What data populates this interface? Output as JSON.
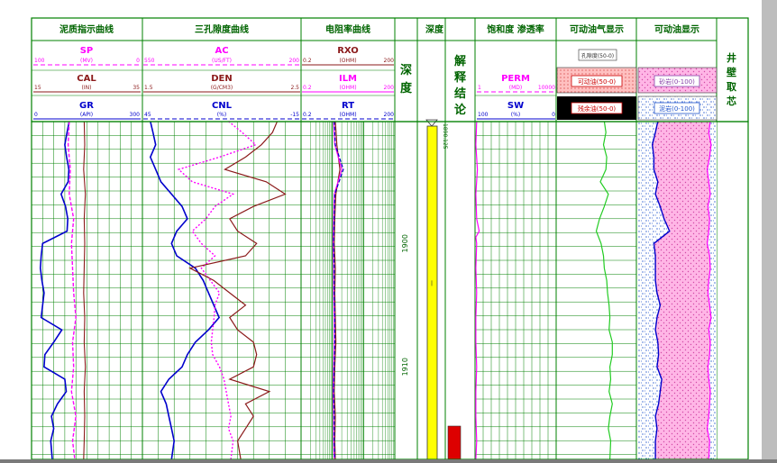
{
  "chart_data": {
    "type": "line",
    "title": "",
    "tracks": [
      {
        "id": "t1",
        "header": "泥质指示曲线",
        "curves": [
          {
            "name": "SP",
            "unit": "(MV)",
            "min": "100",
            "max": "0",
            "color": "#ff00ff"
          },
          {
            "name": "CAL",
            "unit": "(IN)",
            "min": "15",
            "max": "35",
            "color": "#8b1a1a"
          },
          {
            "name": "GR",
            "unit": "(API)",
            "min": "0",
            "max": "300",
            "color": "#0000ff"
          }
        ]
      },
      {
        "id": "t2",
        "header": "三孔隙度曲线",
        "curves": [
          {
            "name": "AC",
            "unit": "(US/FT)",
            "min": "550",
            "max": "200",
            "color": "#ff00ff"
          },
          {
            "name": "DEN",
            "unit": "(G/CM3)",
            "min": "1.5",
            "max": "2.5",
            "color": "#8b1a1a"
          },
          {
            "name": "CNL",
            "unit": "(%)",
            "min": "45",
            "max": "-15",
            "color": "#0000ff"
          }
        ]
      },
      {
        "id": "t3",
        "header": "电阻率曲线",
        "curves": [
          {
            "name": "RXO",
            "unit": "(OHM)",
            "min": "0.2",
            "max": "200",
            "color": "#8b1a1a"
          },
          {
            "name": "ILM",
            "unit": "(OHM)",
            "min": "0.2",
            "max": "200",
            "color": "#ff00ff"
          },
          {
            "name": "RT",
            "unit": "(OHM)",
            "min": "0.2",
            "max": "200",
            "color": "#0000ff"
          }
        ]
      },
      {
        "id": "t4",
        "header": "深度",
        "label": "深度"
      },
      {
        "id": "t5",
        "label": "解释结论"
      },
      {
        "id": "t6",
        "header": "饱和度 渗透率",
        "curves": [
          {
            "name": "PERM",
            "unit": "(MD)",
            "min": "1",
            "max": "10000",
            "color": "#ff00ff"
          },
          {
            "name": "SW",
            "unit": "(%)",
            "min": "100",
            "max": "0",
            "color": "#0000ff"
          }
        ]
      },
      {
        "id": "t7",
        "header": "可动油气显示",
        "legend": [
          "孔隙度(50-0)",
          "可动油(50-0)",
          "残余油(50-0)"
        ]
      },
      {
        "id": "t8",
        "header": "可动油显示",
        "legend": [
          "砂岩(0-100)",
          "泥岩(0-100)"
        ]
      },
      {
        "id": "t9",
        "label": "井壁取芯"
      }
    ],
    "depth_ticks": [
      {
        "depth": 1900,
        "label": "1900"
      },
      {
        "depth": 1910,
        "label": "1910"
      }
    ],
    "depth_top_label": "1890.125",
    "depth_range": [
      1890.125,
      1917.5
    ],
    "curves": {
      "GR": {
        "depth": [
          1890.1,
          1891,
          1892,
          1893,
          1894,
          1895,
          1896,
          1897,
          1898,
          1899,
          1900,
          1901,
          1902,
          1903,
          1904,
          1905,
          1906,
          1907,
          1908,
          1909,
          1910,
          1911,
          1912,
          1913,
          1914,
          1915,
          1916,
          1917.5
        ],
        "value": [
          102,
          96,
          90,
          95,
          101,
          99,
          80,
          92,
          98,
          96,
          30,
          26,
          24,
          28,
          34,
          30,
          26,
          82,
          60,
          36,
          34,
          90,
          94,
          70,
          54,
          60,
          52,
          56
        ]
      },
      "SP": {
        "depth": [
          1890.1,
          1892,
          1894,
          1896,
          1898,
          1900,
          1902,
          1904,
          1906,
          1908,
          1910,
          1912,
          1914,
          1916,
          1917.5
        ],
        "value": [
          66,
          67,
          65,
          66,
          62,
          64,
          63,
          62,
          60,
          63,
          62,
          64,
          60,
          63,
          61
        ]
      },
      "CAL": {
        "depth": [
          1890.1,
          1892,
          1894,
          1896,
          1898,
          1900,
          1902,
          1904,
          1906,
          1908,
          1910,
          1912,
          1914,
          1916,
          1917.5
        ],
        "value": [
          24.5,
          24.6,
          24.4,
          24.7,
          24.5,
          24.6,
          24.5,
          24.4,
          24.6,
          24.5,
          24.7,
          24.5,
          24.6,
          24.5,
          24.4
        ]
      },
      "AC": {
        "depth": [
          1890.1,
          1891,
          1892,
          1893,
          1894,
          1895,
          1896,
          1897,
          1898,
          1899,
          1900,
          1901,
          1902,
          1903,
          1904,
          1905,
          1906,
          1907,
          1908,
          1909,
          1910,
          1911,
          1912,
          1913,
          1914,
          1915,
          1916,
          1917.5
        ],
        "value": [
          360,
          330,
          300,
          380,
          470,
          440,
          350,
          390,
          410,
          440,
          420,
          390,
          420,
          400,
          380,
          390,
          392,
          395,
          398,
          395,
          380,
          370,
          365,
          360,
          355,
          360,
          350,
          355
        ]
      },
      "DEN": {
        "depth": [
          1890.1,
          1891,
          1892,
          1893,
          1894,
          1895,
          1896,
          1897,
          1898,
          1899,
          1900,
          1901,
          1902,
          1903,
          1904,
          1905,
          1906,
          1907,
          1908,
          1909,
          1910,
          1911,
          1912,
          1913,
          1914,
          1915,
          1916,
          1917.5
        ],
        "value": [
          2.35,
          2.32,
          2.25,
          2.15,
          2.02,
          2.28,
          2.4,
          2.2,
          2.05,
          2.1,
          2.22,
          2.15,
          1.8,
          1.95,
          2.05,
          2.15,
          2.05,
          2.1,
          2.2,
          2.22,
          2.2,
          2.05,
          2.3,
          2.15,
          2.2,
          2.15,
          2.1,
          2.12
        ]
      },
      "CNL": {
        "depth": [
          1890.1,
          1891,
          1892,
          1893,
          1894,
          1895,
          1896,
          1897,
          1898,
          1899,
          1900,
          1901,
          1902,
          1903,
          1904,
          1905,
          1906,
          1907,
          1908,
          1909,
          1910,
          1911,
          1912,
          1913,
          1914,
          1915,
          1916,
          1917.5
        ],
        "value": [
          42,
          41,
          40,
          42,
          40,
          38,
          34,
          30,
          28,
          32,
          34,
          32,
          25,
          22,
          20,
          18,
          16,
          20,
          25,
          28,
          30,
          35,
          38,
          36,
          35,
          34,
          33,
          34
        ]
      },
      "RXO": {
        "depth": [
          1890.1,
          1892,
          1894,
          1896,
          1898,
          1900,
          1902,
          1904,
          1906,
          1908,
          1910,
          1912,
          1914,
          1916,
          1917.5
        ],
        "value": [
          2.5,
          2.8,
          3.5,
          2.6,
          2.4,
          2.3,
          2.5,
          2.4,
          2.5,
          2.6,
          2.4,
          2.3,
          2.5,
          2.4,
          2.5
        ]
      },
      "ILM": {
        "depth": [
          1890.1,
          1892,
          1894,
          1896,
          1898,
          1900,
          1902,
          1904,
          1906,
          1908,
          1910,
          1912,
          1914,
          1916,
          1917.5
        ],
        "value": [
          2.2,
          2.4,
          4,
          2.3,
          2.2,
          2.1,
          2.2,
          2.2,
          2.3,
          2.3,
          2.2,
          2.1,
          2.2,
          2.2,
          2.3
        ]
      },
      "RT": {
        "depth": [
          1890.1,
          1892,
          1894,
          1896,
          1898,
          1900,
          1902,
          1904,
          1906,
          1908,
          1910,
          1912,
          1914,
          1916,
          1917.5
        ],
        "value": [
          2.3,
          2.5,
          4.5,
          2.4,
          2.3,
          2.2,
          2.3,
          2.3,
          2.4,
          2.4,
          2.3,
          2.2,
          2.3,
          2.3,
          2.4
        ]
      },
      "PERM": {
        "depth": [
          1890.1,
          1892,
          1894,
          1896,
          1898,
          1899,
          1899.5,
          1900,
          1902,
          1904,
          1906,
          1908,
          1910,
          1912,
          1914,
          1916,
          1917.5
        ],
        "value": [
          1.2,
          1.1,
          1.3,
          1.1,
          1.2,
          1.6,
          1.1,
          1.2,
          1.1,
          1.2,
          1.1,
          1.1,
          1.2,
          1.1,
          1.1,
          1.2,
          1.1
        ]
      },
      "SW": {
        "depth": [
          1890.1,
          1891,
          1892,
          1893,
          1894,
          1895,
          1896,
          1897,
          1898,
          1899,
          1900,
          1901,
          1902,
          1903,
          1904,
          1905,
          1906,
          1907,
          1908,
          1909,
          1910,
          1911,
          1912,
          1913,
          1914,
          1915,
          1916,
          1917.5
        ],
        "value": [
          40,
          38,
          41,
          37,
          38,
          45,
          35,
          40,
          46,
          50,
          44,
          41,
          40,
          37,
          36,
          34,
          33,
          34,
          30,
          30,
          33,
          32,
          34,
          30,
          33,
          35,
          32,
          33
        ]
      },
      "shale_boundary": {
        "depth": [
          1890.1,
          1891,
          1892,
          1893,
          1894,
          1895,
          1896,
          1897,
          1898,
          1899,
          1900,
          1901,
          1902,
          1903,
          1904,
          1905,
          1906,
          1907,
          1908,
          1909,
          1910,
          1911,
          1912,
          1913,
          1914,
          1915,
          1916,
          1917.5
        ],
        "value": [
          25,
          22,
          18,
          20,
          20,
          25,
          22,
          28,
          33,
          40,
          20,
          22,
          22,
          22,
          24,
          28,
          24,
          22,
          25,
          26,
          24,
          30,
          28,
          26,
          22,
          24,
          22,
          22
        ]
      }
    },
    "interpretation": [
      {
        "top": 1914.8,
        "bottom": 1917.5,
        "color": "#dd0000"
      }
    ]
  }
}
